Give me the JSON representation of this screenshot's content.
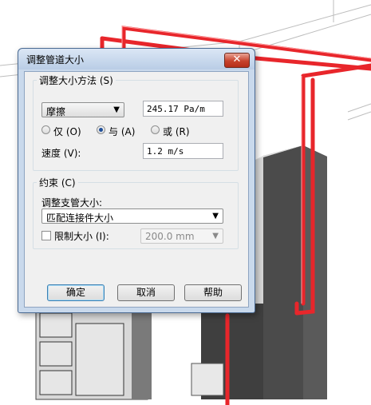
{
  "dialog": {
    "title": "调整管道大小",
    "close_glyph": "✕",
    "method_group": "调整大小方法 (S)",
    "method_select": "摩擦",
    "method_value": "245.17 Pa/m",
    "radio_only": "仅 (O)",
    "radio_and": "与 (A)",
    "radio_or": "或 (R)",
    "speed_label": "速度 (V):",
    "speed_value": "1.2 m/s",
    "constraint_group": "约束 (C)",
    "branch_label": "调整支管大小:",
    "branch_select": "匹配连接件大小",
    "limit_label": "限制大小 (I):",
    "limit_value": "200.0 mm",
    "ok": "确定",
    "cancel": "取消",
    "help": "帮助"
  },
  "colors": {
    "pipe": "#e8262b",
    "titlebar": "#c9d9ec",
    "cabinet": "#4b4b4b"
  }
}
